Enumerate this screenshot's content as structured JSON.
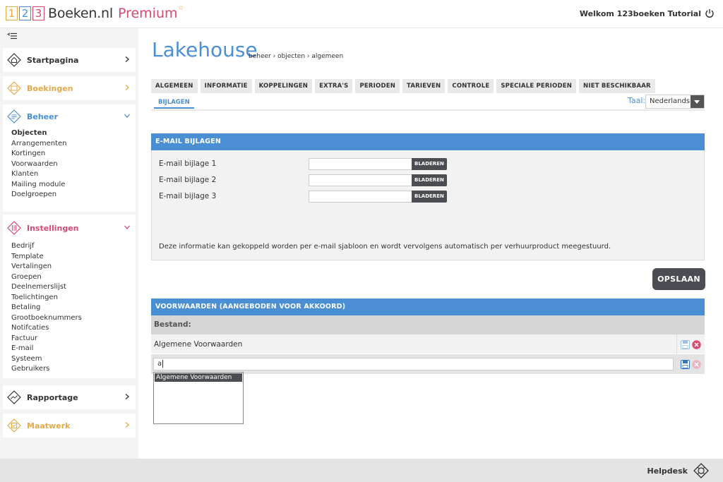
{
  "header": {
    "logo_digits": [
      "1",
      "2",
      "3"
    ],
    "brand": "Boeken.nl",
    "premium": "Premium",
    "welcome": "Welkom 123boeken Tutorial"
  },
  "sidebar": {
    "startpagina": "Startpagina",
    "boekingen": "Boekingen",
    "beheer": {
      "label": "Beheer",
      "items": [
        "Objecten",
        "Arrangementen",
        "Kortingen",
        "Voorwaarden",
        "Klanten",
        "Mailing module",
        "Doelgroepen"
      ]
    },
    "instellingen": {
      "label": "Instellingen",
      "items": [
        "Bedrijf",
        "Template",
        "Vertalingen",
        "Groepen",
        "Deelnemerslijst",
        "Toelichtingen",
        "Betaling",
        "Grootboeknummers",
        "Notifcaties",
        "Factuur",
        "E-mail",
        "Systeem",
        "Gebruikers"
      ]
    },
    "rapportage": "Rapportage",
    "maatwerk": "Maatwerk"
  },
  "main": {
    "title": "Lakehouse",
    "breadcrumb": "beheer › objecten › algemeen",
    "tabs": [
      "ALGEMEEN",
      "INFORMATIE",
      "KOPPELINGEN",
      "EXTRA'S",
      "PERIODEN",
      "TARIEVEN",
      "CONTROLE",
      "SPECIALE PERIODEN",
      "NIET BESCHIKBAAR"
    ],
    "active_tab": "BIJLAGEN",
    "taal_label": "Taal:",
    "taal_value": "Nederlands"
  },
  "email_attachments": {
    "heading": "E-MAIL BIJLAGEN",
    "rows": [
      "E-mail bijlage 1",
      "E-mail bijlage 2",
      "E-mail bijlage 3"
    ],
    "browse_label": "BLADEREN",
    "info": "Deze informatie kan gekoppeld worden per e-mail sjabloon en wordt vervolgens automatisch per verhuurproduct meegestuurd."
  },
  "save_label": "OPSLAAN",
  "terms": {
    "heading": "VOORWAARDEN (AANGEBODEN VOOR AKKOORD)",
    "column": "Bestand:",
    "row": "Algemene Voorwaarden",
    "input_value": "a",
    "suggestion": "Algemene Voorwaarden"
  },
  "footer": {
    "helpdesk": "Helpdesk"
  },
  "colors": {
    "blue": "#4a8fd3",
    "orange": "#e6a94a",
    "pink": "#d9486f",
    "dark": "#4a4e52"
  }
}
